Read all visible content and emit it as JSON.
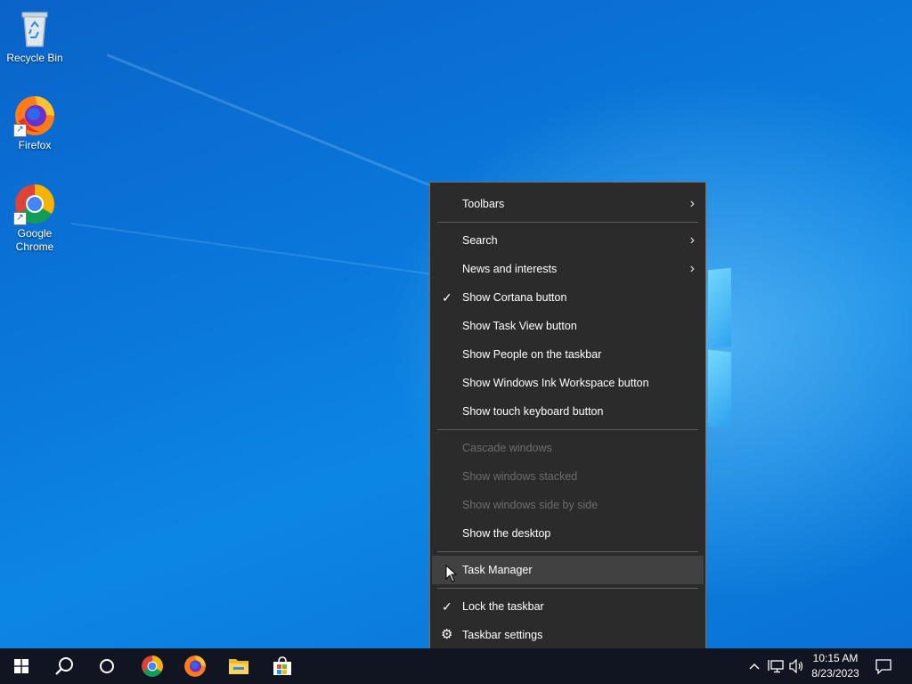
{
  "desktop": {
    "icons": [
      {
        "label": "Recycle Bin",
        "icon": "recycle-bin-icon"
      },
      {
        "label": "Firefox",
        "icon": "firefox-icon"
      },
      {
        "label": "Google Chrome",
        "icon": "chrome-icon"
      }
    ]
  },
  "context_menu": {
    "toolbars": "Toolbars",
    "search": "Search",
    "news_and_interests": "News and interests",
    "show_cortana": "Show Cortana button",
    "show_task_view": "Show Task View button",
    "show_people": "Show People on the taskbar",
    "show_ink_workspace": "Show Windows Ink Workspace button",
    "show_touch_keyboard": "Show touch keyboard button",
    "cascade_windows": "Cascade windows",
    "show_stacked": "Show windows stacked",
    "show_side_by_side": "Show windows side by side",
    "show_desktop": "Show the desktop",
    "task_manager": "Task Manager",
    "lock_taskbar": "Lock the taskbar",
    "taskbar_settings": "Taskbar settings",
    "checked": [
      "Show Cortana button",
      "Lock the taskbar"
    ]
  },
  "taskbar": {
    "pinned": [
      "start-icon",
      "search-icon",
      "cortana-icon",
      "chrome-icon",
      "firefox-icon",
      "file-explorer-icon",
      "microsoft-store-icon"
    ],
    "clock_time": "10:15 AM",
    "clock_date": "8/23/2023"
  },
  "colors": {
    "taskbar_bg": "#101521",
    "menu_bg": "#2b2b2b",
    "menu_disabled_text": "#6d6d6d"
  }
}
